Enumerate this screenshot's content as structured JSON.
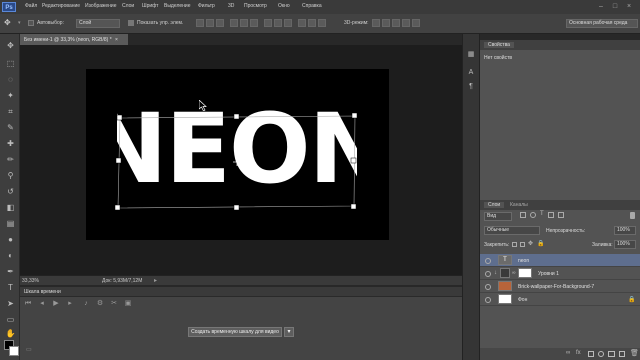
{
  "app": {
    "logo_text": "Ps",
    "menu": [
      "Файл",
      "Редактирование",
      "Изображение",
      "Слои",
      "Шрифт",
      "Выделение",
      "Фильтр",
      "3D",
      "Просмотр",
      "Окно",
      "Справка"
    ],
    "window_controls": [
      "–",
      "□",
      "×"
    ]
  },
  "options_bar": {
    "autoselect_label": "Автовыбор:",
    "autoselect_value": "Слой",
    "show_transform_label": "Показать упр. элем.",
    "mode_3d_label": "3D-режим:",
    "workspace_value": "Основная рабочая среда"
  },
  "document": {
    "tab_title": "Без имени-1 @ 33,3% (neon, RGB/8) *",
    "tab_close": "×",
    "canvas_text": "NEON"
  },
  "status": {
    "zoom": "33,33%",
    "doc_info": "Док: 5,93M/7,12M"
  },
  "timeline": {
    "tab_label": "Шкала времени",
    "create_button": "Создать временную шкалу для видео"
  },
  "properties": {
    "tab_label": "Свойства",
    "empty_text": "Нет свойств"
  },
  "layers": {
    "tab_layers": "Слои",
    "tab_channels": "Каналы",
    "filter_value": "Вид",
    "blend_mode": "Обычные",
    "opacity_label": "Непрозрачность:",
    "opacity_value": "100%",
    "lock_label": "Закрепить:",
    "fill_label": "Заливка:",
    "fill_value": "100%",
    "items": [
      {
        "name": "neon",
        "type": "text",
        "selected": true
      },
      {
        "name": "Уровни 1",
        "type": "adjustment",
        "selected": false
      },
      {
        "name": "Brick-wallpaper-For-Background-7",
        "type": "image",
        "selected": false
      },
      {
        "name": "Фон",
        "type": "background",
        "selected": false
      }
    ]
  },
  "colors": {
    "accent": "#2a4a8a",
    "selected_layer": "#5e6e8e",
    "brick": "#b8643a"
  }
}
